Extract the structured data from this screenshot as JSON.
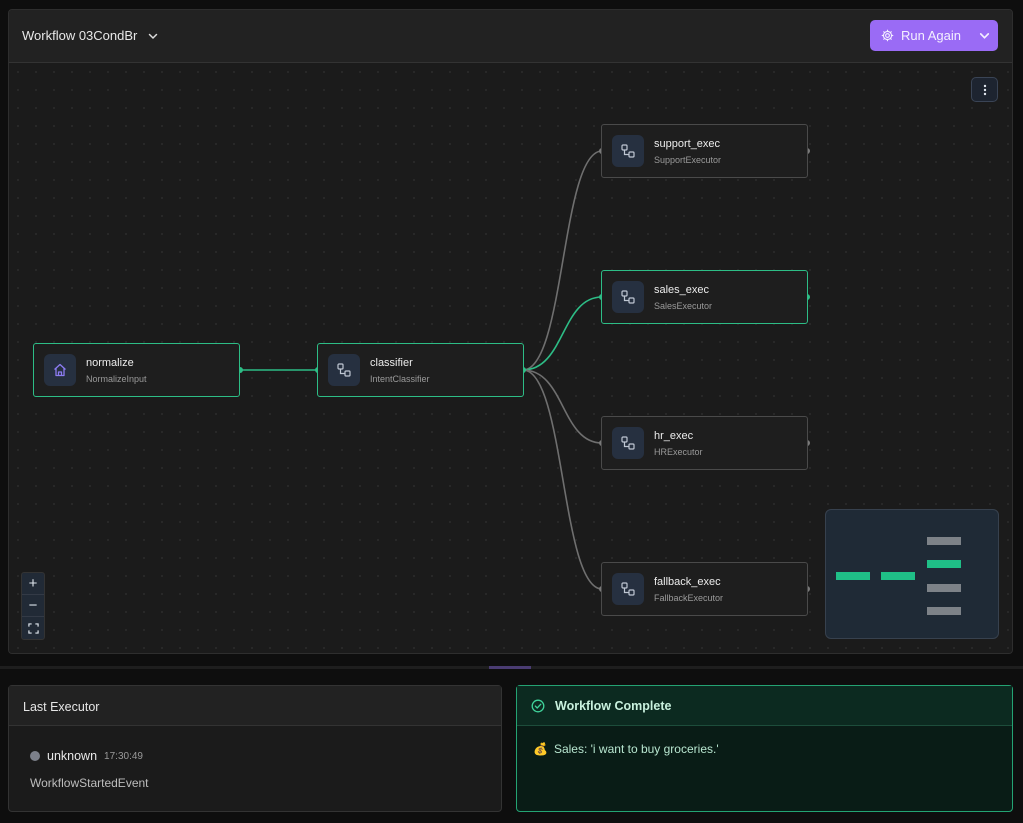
{
  "header": {
    "workflow_title": "Workflow 03CondBr",
    "run_button_label": "Run Again"
  },
  "nodes": [
    {
      "id": "normalize",
      "name": "normalize",
      "type": "NormalizeInput",
      "icon": "home-icon",
      "active": true
    },
    {
      "id": "classifier",
      "name": "classifier",
      "type": "IntentClassifier",
      "icon": "executor-icon",
      "active": true
    },
    {
      "id": "support_exec",
      "name": "support_exec",
      "type": "SupportExecutor",
      "icon": "executor-icon",
      "active": false
    },
    {
      "id": "sales_exec",
      "name": "sales_exec",
      "type": "SalesExecutor",
      "icon": "executor-icon",
      "active": true
    },
    {
      "id": "hr_exec",
      "name": "hr_exec",
      "type": "HRExecutor",
      "icon": "executor-icon",
      "active": false
    },
    {
      "id": "fallback_exec",
      "name": "fallback_exec",
      "type": "FallbackExecutor",
      "icon": "executor-icon",
      "active": false
    }
  ],
  "zoom_controls": {
    "zoom_in": "+",
    "zoom_out": "−"
  },
  "last_executor": {
    "title": "Last Executor",
    "executor_name": "unknown",
    "time": "17:30:49",
    "event": "WorkflowStartedEvent"
  },
  "completion": {
    "title": "Workflow Complete",
    "message": "Sales: 'i want to buy groceries.'",
    "message_icon": "💰"
  },
  "colors": {
    "accent": "#9a6bf5",
    "active_edge": "#2dbd86",
    "inactive_edge": "#6f6f6f"
  }
}
